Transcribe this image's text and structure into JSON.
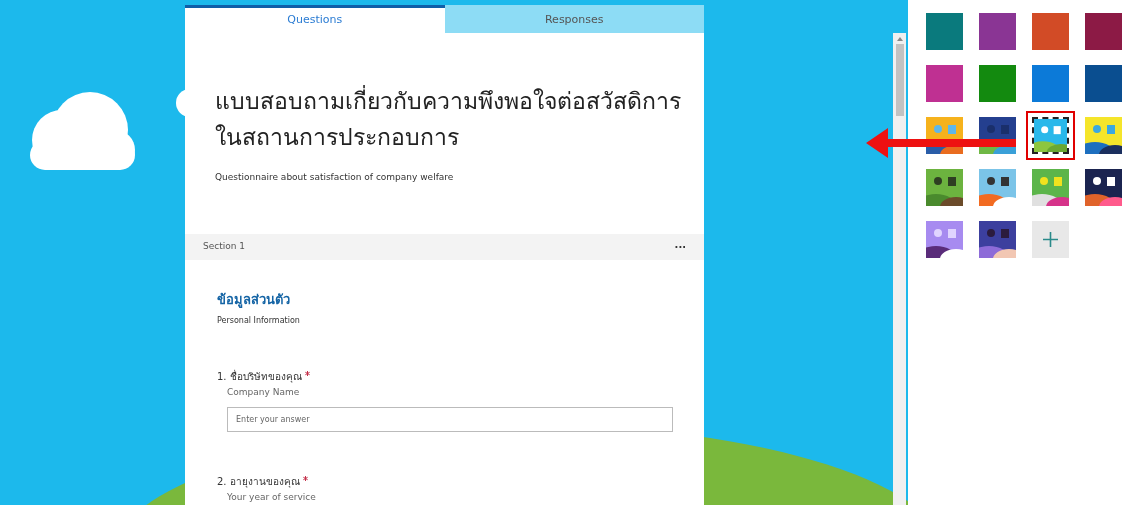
{
  "tabs": [
    {
      "label": "Questions",
      "selected": true
    },
    {
      "label": "Responses",
      "selected": false
    }
  ],
  "form": {
    "title": "แบบสอบถามเกี่ยวกับความพึงพอใจต่อสวัสดิการในสถานการประกอบการ",
    "description": "Questionnaire about satisfaction of company welfare"
  },
  "section": {
    "label": "Section 1",
    "menu": "···",
    "title": "ข้อมูลส่วนตัว",
    "subtitle": "Personal Information"
  },
  "questions": [
    {
      "number": "1.",
      "title": "ชื่อบริษัทของคุณ",
      "required": true,
      "subtitle": "Company Name",
      "placeholder": "Enter your answer"
    },
    {
      "number": "2.",
      "title": "อายุงานของคุณ",
      "required": true,
      "subtitle": "Your year of service"
    }
  ],
  "themes": [
    {
      "kind": "color",
      "color": "#0a7a7d",
      "selected": false
    },
    {
      "kind": "color",
      "color": "#8a3594",
      "selected": false
    },
    {
      "kind": "color",
      "color": "#d24b26",
      "selected": false
    },
    {
      "kind": "color",
      "color": "#8c1a45",
      "selected": false
    },
    {
      "kind": "color",
      "color": "#bf3092",
      "selected": false
    },
    {
      "kind": "color",
      "color": "#138a0f",
      "selected": false
    },
    {
      "kind": "color",
      "color": "#0c7ad8",
      "selected": false
    },
    {
      "kind": "color",
      "color": "#0a4e90",
      "selected": false
    },
    {
      "kind": "picture",
      "selected": false
    },
    {
      "kind": "picture",
      "selected": false
    },
    {
      "kind": "picture",
      "selected": true
    },
    {
      "kind": "picture",
      "selected": false
    },
    {
      "kind": "picture",
      "selected": false
    },
    {
      "kind": "picture",
      "selected": false
    },
    {
      "kind": "picture",
      "selected": false
    },
    {
      "kind": "picture",
      "selected": false
    },
    {
      "kind": "picture",
      "selected": false
    },
    {
      "kind": "picture",
      "selected": false
    },
    {
      "kind": "add",
      "selected": false
    }
  ]
}
